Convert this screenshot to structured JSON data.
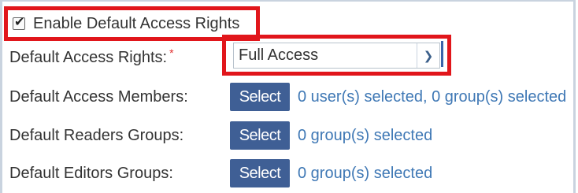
{
  "enable_default_access": {
    "label": "Enable Default Access Rights",
    "checked": true
  },
  "default_access_rights": {
    "label": "Default Access Rights:",
    "required_marker": "*",
    "selected_value": "Full Access"
  },
  "default_access_members": {
    "label": "Default Access Members:",
    "button_label": "Select",
    "status": "0 user(s) selected, 0 group(s) selected"
  },
  "default_readers_groups": {
    "label": "Default Readers Groups:",
    "button_label": "Select",
    "status": "0 group(s) selected"
  },
  "default_editors_groups": {
    "label": "Default Editors Groups:",
    "button_label": "Select",
    "status": "0 group(s) selected"
  },
  "colors": {
    "highlight_border": "#e1161b",
    "button_bg": "#3f5f95",
    "link_text": "#3f78b5",
    "required": "#e12b2b"
  }
}
